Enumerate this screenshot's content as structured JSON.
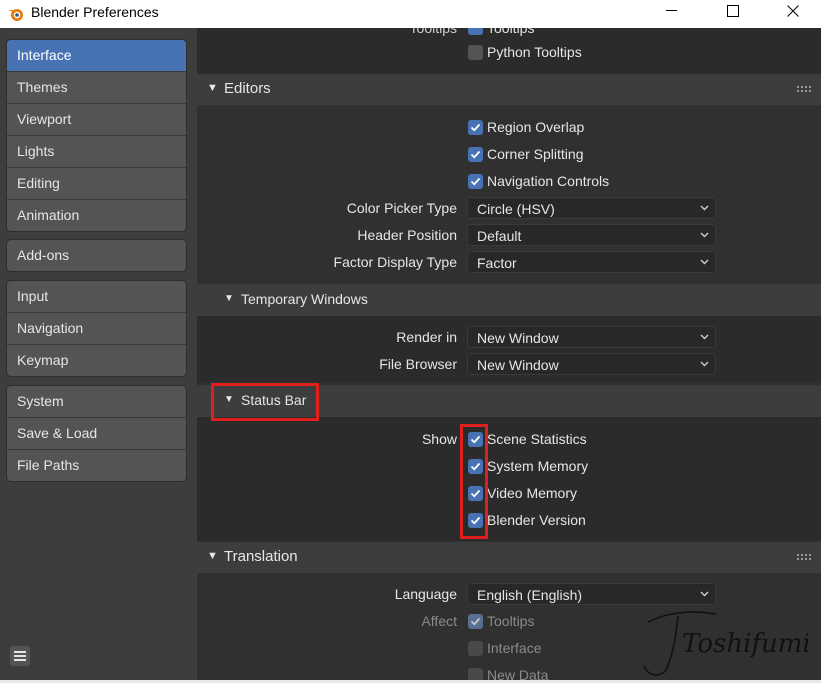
{
  "window": {
    "title": "Blender Preferences",
    "controls": [
      "minimize-icon",
      "maximize-icon",
      "close-icon"
    ]
  },
  "sidebar": {
    "groups": [
      [
        "Interface",
        "Themes",
        "Viewport",
        "Lights",
        "Editing",
        "Animation"
      ],
      [
        "Add-ons"
      ],
      [
        "Input",
        "Navigation",
        "Keymap"
      ],
      [
        "System",
        "Save & Load",
        "File Paths"
      ]
    ],
    "active": "Interface",
    "menu_icon": "hamburger-icon"
  },
  "top_partial": {
    "tooltips_label_partial": "Tooltips",
    "tooltips_cb_partial": "Tooltips",
    "python_tooltips": "Python Tooltips"
  },
  "editors": {
    "title": "Editors",
    "region_overlap": "Region Overlap",
    "corner_splitting": "Corner Splitting",
    "navigation_controls": "Navigation Controls",
    "color_picker_label": "Color Picker Type",
    "color_picker_value": "Circle (HSV)",
    "header_position_label": "Header Position",
    "header_position_value": "Default",
    "factor_display_label": "Factor Display Type",
    "factor_display_value": "Factor"
  },
  "temporary_windows": {
    "title": "Temporary Windows",
    "render_in_label": "Render in",
    "render_in_value": "New Window",
    "file_browser_label": "File Browser",
    "file_browser_value": "New Window"
  },
  "status_bar": {
    "title": "Status Bar",
    "show_label": "Show",
    "scene_statistics": "Scene Statistics",
    "system_memory": "System Memory",
    "video_memory": "Video Memory",
    "blender_version": "Blender Version"
  },
  "translation": {
    "title": "Translation",
    "language_label": "Language",
    "language_value": "English (English)",
    "affect_label": "Affect",
    "tooltips": "Tooltips",
    "interface": "Interface",
    "new_data": "New Data"
  },
  "watermark": "Toshifumi",
  "colors": {
    "accent": "#4772b3",
    "highlight": "#e01e1e"
  }
}
